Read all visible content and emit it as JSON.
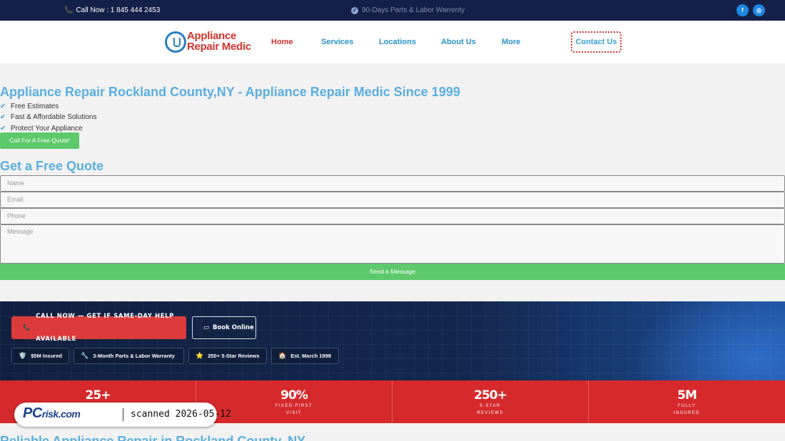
{
  "topbar": {
    "call_text": "Call Now : 1 845 444 2453",
    "warranty_text": "90-Days Parts & Labor Warrenty",
    "social": [
      {
        "name": "facebook-icon",
        "glyph": "f"
      },
      {
        "name": "instagram-icon",
        "glyph": "◎"
      }
    ]
  },
  "header": {
    "logo_line1": "Appliance",
    "logo_line2": "Repair Medic",
    "nav": [
      "Home",
      "Services",
      "Locations",
      "About Us",
      "More"
    ],
    "contact_label": "Contact Us"
  },
  "hero": {
    "title": "Appliance Repair Rockland County,NY - Appliance Repair Medic Since 1999",
    "bullets": [
      "Free Estimates",
      "Fast & Affordable Solutions",
      "Protect Your Appliance"
    ],
    "quote_button": "Call For A Free Quote!"
  },
  "form": {
    "title": "Get a Free Quote",
    "name_placeholder": "Name",
    "email_placeholder": "Email",
    "phone_placeholder": "Phone",
    "message_placeholder": "Message",
    "send_label": "Send a Message"
  },
  "promo": {
    "call_button": "CALL NOW — GET IF SAME-DAY HELP AVAILABLE",
    "book_button": "Book Online",
    "badges": [
      {
        "icon": "🛡️",
        "label": "$5M Insured"
      },
      {
        "icon": "🔧",
        "label": "3-Month Parts & Labor Warranty"
      },
      {
        "icon": "⭐",
        "label": "250+ 5-Star Reviews"
      },
      {
        "icon": "🏠",
        "label": "Est. March 1999"
      }
    ]
  },
  "stats": [
    {
      "num": "25+",
      "line1": "",
      "line2": ""
    },
    {
      "num": "90%",
      "line1": "FIXED FIRST",
      "line2": "VISIT"
    },
    {
      "num": "250+",
      "line1": "5-STAR",
      "line2": "REVIEWS"
    },
    {
      "num": "5M",
      "line1": "FULLY",
      "line2": "INSURED"
    }
  ],
  "bottom_title": "Reliable Appliance Repair in Rockland County, NY",
  "watermark": {
    "brand": "PC",
    "brand_suffix": "risk.com",
    "scan_text": "scanned 2026-05-12"
  }
}
